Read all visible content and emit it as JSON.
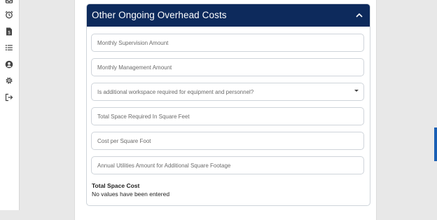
{
  "sidebar": {
    "icons": [
      "inbox-icon",
      "alarm-clock-icon",
      "document-dollar-icon",
      "list-icon",
      "user-circle-icon",
      "gear-icon",
      "logout-icon"
    ]
  },
  "section": {
    "title": "Other Ongoing Overhead Costs",
    "header_color": "#0d2a5c"
  },
  "fields": {
    "monthly_supervision_placeholder": "Monthly Supervision Amount",
    "monthly_management_placeholder": "Monthly Management Amount",
    "additional_workspace_select_value": "Is additional workspace required for equipment and personnel?",
    "total_space_placeholder": "Total Space Required In Square Feet",
    "cost_per_sqft_placeholder": "Cost per Square Foot",
    "annual_utilities_placeholder": "Annual Utilities Amount for Additional Square Footage"
  },
  "total": {
    "label": "Total Space Cost",
    "value": "No values have been entered"
  },
  "colors": {
    "accent": "#1a5fb4",
    "border": "#cfd4da"
  }
}
